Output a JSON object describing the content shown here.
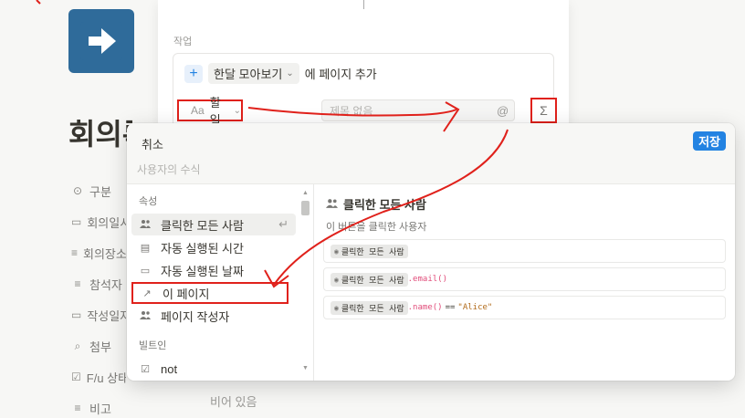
{
  "page": {
    "title": "회의록",
    "properties": [
      {
        "icon": "target-icon",
        "glyph": "⊙",
        "label": "구분"
      },
      {
        "icon": "calendar-icon",
        "glyph": "▭",
        "label": "회의일시"
      },
      {
        "icon": "text-icon",
        "glyph": "≡",
        "label": "회의장소"
      },
      {
        "icon": "text-icon",
        "glyph": "≡",
        "label": "참석자"
      },
      {
        "icon": "calendar-icon",
        "glyph": "▭",
        "label": "작성일자"
      },
      {
        "icon": "paperclip-icon",
        "glyph": "⌕",
        "label": "첨부"
      },
      {
        "icon": "checkbox-icon",
        "glyph": "☑",
        "label": "F/u 상태"
      },
      {
        "icon": "text-icon",
        "glyph": "≡",
        "label": "비고"
      }
    ],
    "empty_value": "비어 있음"
  },
  "setup": {
    "section_label": "작업",
    "add_page_db": "한달 모아보기",
    "add_page_suffix": "에 페이지 추가",
    "prop_name_prefix": "Aa",
    "prop_name": "할일",
    "input_placeholder": "제목 없음",
    "at_symbol": "@",
    "sigma_symbol": "Σ"
  },
  "editor": {
    "cancel_label": "취소",
    "save_label": "저장",
    "formula_placeholder": "사용자의 수식",
    "groups": [
      {
        "label": "속성",
        "items": [
          {
            "name": "people-icon",
            "glyph": "👥",
            "label": "클릭한 모든 사람",
            "selected": true
          },
          {
            "name": "clock-icon",
            "glyph": "▤",
            "label": "자동 실행된 시간"
          },
          {
            "name": "calendar-icon",
            "glyph": "▭",
            "label": "자동 실행된 날짜"
          },
          {
            "name": "arrow-upright-icon",
            "glyph": "↗",
            "label": "이 페이지"
          },
          {
            "name": "people-icon",
            "glyph": "👥",
            "label": "페이지 작성자"
          }
        ]
      },
      {
        "label": "빌트인",
        "items": [
          {
            "name": "checkbox-icon",
            "glyph": "☑",
            "label": "not"
          }
        ]
      }
    ],
    "detail": {
      "title": "클릭한 모든 사람",
      "description": "이 버튼을 클릭한 사용자",
      "examples": [
        {
          "token": "클릭한 모든 사람",
          "rest": ""
        },
        {
          "token": "클릭한 모든 사람",
          "fn": ".email()",
          "rest": ""
        },
        {
          "token": "클릭한 모든 사람",
          "fn": ".name()",
          "op": "==",
          "str": "\"Alice\""
        }
      ]
    }
  }
}
